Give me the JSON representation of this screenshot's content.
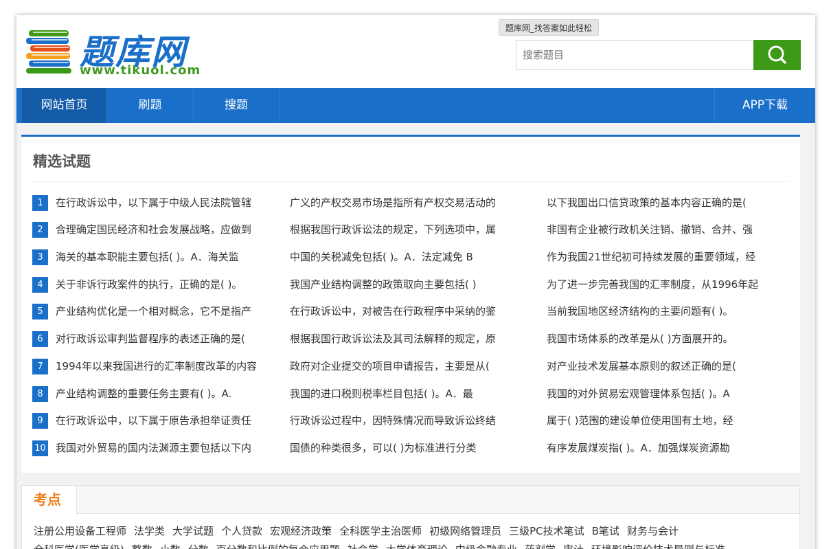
{
  "header": {
    "logo_text": "题库网",
    "logo_url": "www.tikuol.com",
    "tooltip": "题库网_找答案如此轻松",
    "search_placeholder": "搜索题目"
  },
  "nav": {
    "items": [
      "网站首页",
      "刷题",
      "搜题"
    ],
    "app_download": "APP下载"
  },
  "featured": {
    "title": "精选试题",
    "rows": [
      {
        "num": "1",
        "col1": "在行政诉讼中，以下属于中级人民法院管辖",
        "col2": "广义的产权交易市场是指所有产权交易活动的",
        "col3": "以下我国出口信贷政策的基本内容正确的是("
      },
      {
        "num": "2",
        "col1": "合理确定国民经济和社会发展战略，应做到",
        "col2": "根据我国行政诉讼法的规定，下列选项中，属",
        "col3": "非国有企业被行政机关注销、撤销、合并、强"
      },
      {
        "num": "3",
        "col1": "海关的基本职能主要包括( )。A．海关监",
        "col2": "中国的关税减免包括( )。A．法定减免 B",
        "col3": "作为我国21世纪初可持续发展的重要领域，经"
      },
      {
        "num": "4",
        "col1": "关于非诉行政案件的执行，正确的是( )。",
        "col2": "我国产业结构调整的政策取向主要包括( )",
        "col3": "为了进一步完善我国的汇率制度，从1996年起"
      },
      {
        "num": "5",
        "col1": "产业结构优化是一个相对概念，它不是指产",
        "col2": "在行政诉讼中，对被告在行政程序中采纳的鉴",
        "col3": "当前我国地区经济结构的主要问题有( )。"
      },
      {
        "num": "6",
        "col1": "对行政诉讼审判监督程序的表述正确的是(",
        "col2": "根据我国行政诉讼法及其司法解释的规定，原",
        "col3": "我国市场体系的改革是从( )方面展开的。"
      },
      {
        "num": "7",
        "col1": "1994年以来我国进行的汇率制度改革的内容",
        "col2": "政府对企业提交的项目申请报告，主要是从(",
        "col3": "对产业技术发展基本原则的叙述正确的是("
      },
      {
        "num": "8",
        "col1": "产业结构调整的重要任务主要有( )。A.",
        "col2": "我国的进口税则税率栏目包括( )。A．最",
        "col3": "我国的对外贸易宏观管理体系包括( )。A"
      },
      {
        "num": "9",
        "col1": "在行政诉讼中，以下属于原告承担举证责任",
        "col2": "行政诉讼过程中，因特殊情况而导致诉讼终结",
        "col3": "属于( )范围的建设单位使用国有土地，经"
      },
      {
        "num": "10",
        "col1": "我国对外贸易的国内法渊源主要包括以下内",
        "col2": "国债的种类很多，可以( )为标准进行分类",
        "col3": "有序发展煤炭指( )。A．加强煤炭资源勘"
      }
    ]
  },
  "kaodian": {
    "title": "考点",
    "line1": [
      "注册公用设备工程师",
      "法学类",
      "大学试题",
      "个人贷款",
      "宏观经济政策",
      "全科医学主治医师",
      "初级网络管理员",
      "三级PC技术笔试",
      "B笔试",
      "财务与会计"
    ],
    "line2": [
      "全科医学(医学高级)",
      "整数",
      "小数",
      "分数",
      "百分数和比例的复合应用题",
      "社会学",
      "大学体育理论",
      "中级金融专业",
      "药剂学",
      "审计",
      "环境影响评价技术导则与标准"
    ]
  },
  "colors": {
    "brand_blue": "#1a6fc9",
    "search_green": "#3c9a17",
    "kaodian_orange": "#f07c13"
  }
}
